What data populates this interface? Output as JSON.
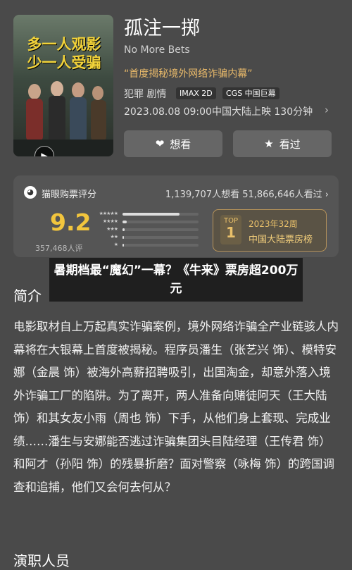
{
  "movie": {
    "title": "孤注一掷",
    "english_title": "No More Bets",
    "tagline": "“首度揭秘境外网络诈骗内幕”",
    "genre": "犯罪 剧情",
    "badges": [
      "IMAX 2D",
      "CGS 中国巨幕"
    ],
    "release": "2023.08.08 09:00中国大陆上映 130分钟"
  },
  "poster": {
    "line1": "多一人观影",
    "line2": "少一人受骗"
  },
  "actions": {
    "want": "想看",
    "watched": "看过"
  },
  "rating": {
    "source": "猫眼购票评分",
    "stats": "1,139,707人想看 51,866,646人看过",
    "score": "9.2",
    "count": "357,468人评",
    "distribution": [
      {
        "stars": "★★★★★",
        "fraction": 0.75
      },
      {
        "stars": "★★★★",
        "fraction": 0.06
      },
      {
        "stars": "★★★",
        "fraction": 0.03
      },
      {
        "stars": "★★",
        "fraction": 0.02
      },
      {
        "stars": "★",
        "fraction": 0.02
      }
    ],
    "rank_top": "TOP",
    "rank_num": "1",
    "rank_week": "2023年32周",
    "rank_name": "中国大陆票房榜"
  },
  "overlay_news": "暑期档最“魔幻”一幕？《牛来》票房超200万元",
  "intro": {
    "heading": "简介",
    "text": "电影取材自上万起真实诈骗案例，境外网络诈骗全产业链骇人内幕将在大银幕上首度被揭秘。程序员潘生（张艺兴 饰）、模特安娜（金晨 饰）被海外高薪招聘吸引，出国淘金，却意外落入境外诈骗工厂的陷阱。为了离开，两人准备向赌徒阿天（王大陆 饰）和其女友小雨（周也 饰）下手，从他们身上套现、完成业绩……潘生与安娜能否逃过诈骗集团头目陆经理（王传君 饰）和阿才（孙阳 饰）的残暴折磨？面对警察（咏梅 饰）的跨国调查和追捕，他们又会何去何从？"
  },
  "cast_heading": "演职人员",
  "colors": {
    "background": "#4a4a4a",
    "score": "#f2c53d",
    "tagline": "#e8b96a",
    "rank_border": "#b8945a"
  }
}
